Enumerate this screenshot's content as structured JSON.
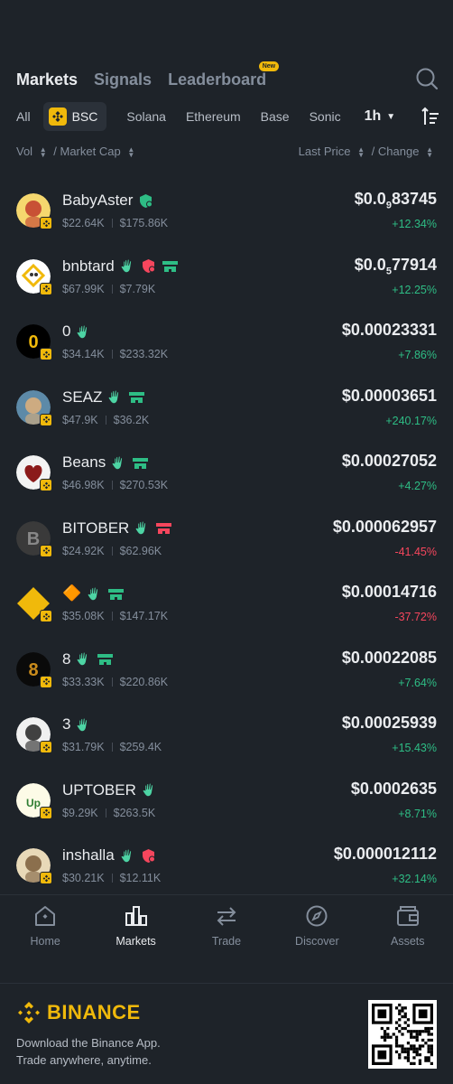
{
  "header": {
    "tabs": [
      {
        "label": "Markets",
        "active": true
      },
      {
        "label": "Signals",
        "active": false
      },
      {
        "label": "Leaderboard",
        "active": false,
        "badge": "New"
      }
    ]
  },
  "chains": {
    "items": [
      "All",
      "BSC",
      "Solana",
      "Ethereum",
      "Base",
      "Sonic"
    ],
    "active": "BSC",
    "interval": "1h"
  },
  "columns": {
    "vol": "Vol",
    "market_cap": "Market Cap",
    "last_price": "Last Price",
    "change": "Change",
    "slash": "/"
  },
  "tokens": [
    {
      "name": "BabyAster",
      "vol": "$22.64K",
      "mcap": "$175.86K",
      "price_prefix": "$0.0",
      "price_sub": "9",
      "price_rest": "83745",
      "change": "+12.34%",
      "dir": "up",
      "tags": [
        "shield-green"
      ]
    },
    {
      "name": "bnbtard",
      "vol": "$67.99K",
      "mcap": "$7.79K",
      "price_prefix": "$0.0",
      "price_sub": "5",
      "price_rest": "77914",
      "change": "+12.25%",
      "dir": "up",
      "tags": [
        "hand",
        "shield-red",
        "card-green"
      ]
    },
    {
      "name": "0",
      "vol": "$34.14K",
      "mcap": "$233.32K",
      "price_prefix": "$0.00023331",
      "price_sub": "",
      "price_rest": "",
      "change": "+7.86%",
      "dir": "up",
      "tags": [
        "hand"
      ]
    },
    {
      "name": "SEAZ",
      "vol": "$47.9K",
      "mcap": "$36.2K",
      "price_prefix": "$0.00003651",
      "price_sub": "",
      "price_rest": "",
      "change": "+240.17%",
      "dir": "up",
      "tags": [
        "hand",
        "card-green"
      ]
    },
    {
      "name": "Beans",
      "vol": "$46.98K",
      "mcap": "$270.53K",
      "price_prefix": "$0.00027052",
      "price_sub": "",
      "price_rest": "",
      "change": "+4.27%",
      "dir": "up",
      "tags": [
        "hand",
        "card-green"
      ]
    },
    {
      "name": "BITOBER",
      "vol": "$24.92K",
      "mcap": "$62.96K",
      "price_prefix": "$0.000062957",
      "price_sub": "",
      "price_rest": "",
      "change": "-41.45%",
      "dir": "down",
      "tags": [
        "hand",
        "card-red"
      ]
    },
    {
      "name": "🔶",
      "vol": "$35.08K",
      "mcap": "$147.17K",
      "price_prefix": "$0.00014716",
      "price_sub": "",
      "price_rest": "",
      "change": "-37.72%",
      "dir": "down",
      "tags": [
        "hand",
        "card-green"
      ]
    },
    {
      "name": "8",
      "vol": "$33.33K",
      "mcap": "$220.86K",
      "price_prefix": "$0.00022085",
      "price_sub": "",
      "price_rest": "",
      "change": "+7.64%",
      "dir": "up",
      "tags": [
        "hand",
        "card-green"
      ]
    },
    {
      "name": "3",
      "vol": "$31.79K",
      "mcap": "$259.4K",
      "price_prefix": "$0.00025939",
      "price_sub": "",
      "price_rest": "",
      "change": "+15.43%",
      "dir": "up",
      "tags": [
        "hand"
      ]
    },
    {
      "name": "UPTOBER",
      "vol": "$9.29K",
      "mcap": "$263.5K",
      "price_prefix": "$0.0002635",
      "price_sub": "",
      "price_rest": "",
      "change": "+8.71%",
      "dir": "up",
      "tags": [
        "hand"
      ]
    },
    {
      "name": "inshalla",
      "vol": "$30.21K",
      "mcap": "$12.11K",
      "price_prefix": "$0.000012112",
      "price_sub": "",
      "price_rest": "",
      "change": "+32.14%",
      "dir": "up",
      "tags": [
        "hand",
        "shield-red"
      ]
    }
  ],
  "nav": [
    {
      "label": "Home",
      "icon": "home-icon",
      "active": false
    },
    {
      "label": "Markets",
      "icon": "markets-icon",
      "active": true
    },
    {
      "label": "Trade",
      "icon": "trade-icon",
      "active": false
    },
    {
      "label": "Discover",
      "icon": "discover-icon",
      "active": false
    },
    {
      "label": "Assets",
      "icon": "assets-icon",
      "active": false
    }
  ],
  "footer": {
    "brand": "BINANCE",
    "line1": "Download the Binance App.",
    "line2": "Trade anywhere, anytime."
  },
  "colors": {
    "background": "#1e2329",
    "accent": "#f0b90b",
    "up": "#2ebd85",
    "down": "#f6465d"
  }
}
